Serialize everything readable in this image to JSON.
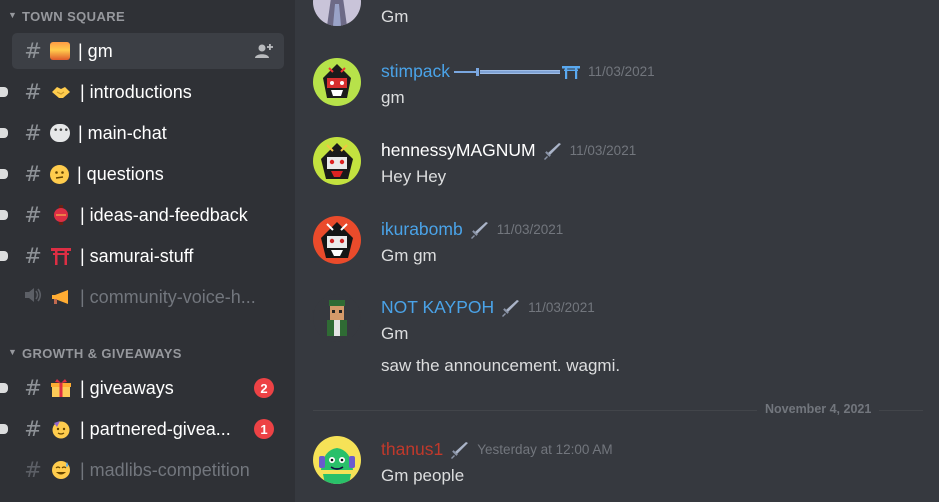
{
  "sidebar": {
    "categories": [
      {
        "label": "TOWN SQUARE"
      },
      {
        "label": "GROWTH & GIVEAWAYS"
      }
    ],
    "channels": [
      {
        "name": "| gm",
        "icon": "sunrise-icon"
      },
      {
        "name": "| introductions",
        "icon": "handshake-icon"
      },
      {
        "name": "| main-chat",
        "icon": "speech-bubble-icon"
      },
      {
        "name": "| questions",
        "icon": "thinking-face-icon"
      },
      {
        "name": "| ideas-and-feedback",
        "icon": "lantern-icon"
      },
      {
        "name": "| samurai-stuff",
        "icon": "torii-icon"
      },
      {
        "name": "| community-voice-h...",
        "icon": "horn-icon"
      },
      {
        "name": "| giveaways",
        "icon": "gift-icon",
        "badge": "2"
      },
      {
        "name": "| partnered-giveа...",
        "icon": "party-face-icon",
        "badge": "1"
      },
      {
        "name": "| madlibs-competition",
        "icon": "sweat-smile-icon"
      }
    ]
  },
  "chat": {
    "messages": [
      {
        "text": "Gm"
      },
      {
        "author": "stimpack",
        "decoration": "sword-torii-icon",
        "timestamp": "11/03/2021",
        "text": "gm",
        "color": "#4aa3e8"
      },
      {
        "author": "hennessyMAGNUM",
        "timestamp": "11/03/2021",
        "text": "Hey Hey",
        "color": "#ffffff"
      },
      {
        "author": "ikurabomb",
        "timestamp": "11/03/2021",
        "text": "Gm gm",
        "color": "#4aa3e8"
      },
      {
        "author": "NOT KAYPOH",
        "timestamp": "11/03/2021",
        "text": "Gm",
        "text2": "saw the announcement. wagmi.",
        "color": "#4aa3e8"
      },
      {
        "author": "thanus1",
        "timestamp": "Yesterday at 12:00 AM",
        "text": "Gm people",
        "color": "#c0392b"
      }
    ],
    "date_divider": "November 4, 2021"
  },
  "colors": {
    "sidebar_bg": "#2f3136",
    "chat_bg": "#36393f",
    "badge_red": "#ed4245",
    "link_blue": "#4aa3e8"
  }
}
